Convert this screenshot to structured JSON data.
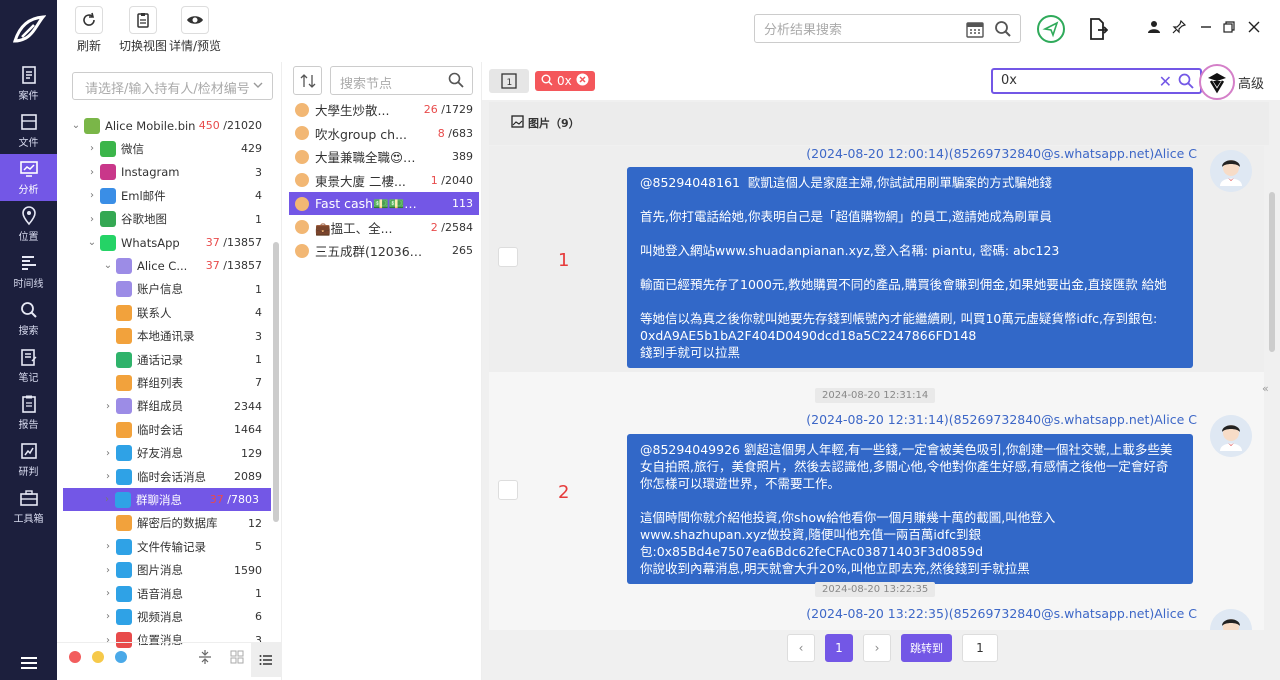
{
  "toolbar": {
    "refresh": "刷新",
    "switch_view": "切换视图",
    "details": "详情/预览",
    "search_placeholder": "分析结果搜索"
  },
  "leftnav": [
    {
      "label": "案件",
      "icon": "case-icon"
    },
    {
      "label": "文件",
      "icon": "folder-icon"
    },
    {
      "label": "分析",
      "icon": "analysis-icon",
      "active": true
    },
    {
      "label": "位置",
      "icon": "location-icon"
    },
    {
      "label": "时间线",
      "icon": "timeline-icon"
    },
    {
      "label": "搜索",
      "icon": "search-icon"
    },
    {
      "label": "笔记",
      "icon": "note-icon"
    },
    {
      "label": "报告",
      "icon": "report-icon"
    },
    {
      "label": "研判",
      "icon": "judge-icon"
    },
    {
      "label": "工具箱",
      "icon": "toolbox-icon"
    }
  ],
  "tree": {
    "placeholder": "请选择/输入持有人/检材编号",
    "items": [
      {
        "label": "Alice Mobile.bin",
        "red": "450",
        "count": "/21020",
        "level": 0,
        "arrow": "down",
        "icon": "android-icon",
        "color": "#7ab648"
      },
      {
        "label": "微信",
        "count": "429",
        "level": 1,
        "arrow": "right",
        "icon": "wechat-icon",
        "color": "#3bb54a"
      },
      {
        "label": "Instagram",
        "count": "3",
        "level": 1,
        "arrow": "right",
        "icon": "instagram-icon",
        "color": "#c9378a"
      },
      {
        "label": "Eml邮件",
        "count": "4",
        "level": 1,
        "arrow": "right",
        "icon": "mail-icon",
        "color": "#3a8ee6"
      },
      {
        "label": "谷歌地图",
        "count": "1",
        "level": 1,
        "arrow": "right",
        "icon": "map-icon",
        "color": "#34a853"
      },
      {
        "label": "WhatsApp",
        "red": "37",
        "count": "/13857",
        "level": 1,
        "arrow": "down",
        "icon": "whatsapp-icon",
        "color": "#25d366"
      },
      {
        "label": "Alice C...",
        "red": "37",
        "count": "/13857",
        "level": 2,
        "arrow": "down",
        "icon": "user-icon",
        "color": "#9c8ce6"
      },
      {
        "label": "账户信息",
        "count": "1",
        "level": 3,
        "icon": "account-icon",
        "color": "#9c8ce6"
      },
      {
        "label": "联系人",
        "count": "4",
        "level": 3,
        "icon": "contact-icon",
        "color": "#f2a23c"
      },
      {
        "label": "本地通讯录",
        "count": "3",
        "level": 3,
        "icon": "addressbook-icon",
        "color": "#f2a23c"
      },
      {
        "label": "通话记录",
        "count": "1",
        "level": 3,
        "icon": "phone-icon",
        "color": "#2fb36b"
      },
      {
        "label": "群组列表",
        "count": "7",
        "level": 3,
        "icon": "grouplist-icon",
        "color": "#f2a23c"
      },
      {
        "label": "群组成员",
        "count": "2344",
        "level": 3,
        "arrow": "right",
        "icon": "groupmember-icon",
        "color": "#9c8ce6"
      },
      {
        "label": "临时会话",
        "count": "1464",
        "level": 3,
        "icon": "temp-session-icon",
        "color": "#f2a23c"
      },
      {
        "label": "好友消息",
        "count": "129",
        "level": 3,
        "arrow": "right",
        "icon": "chat-bubble-icon",
        "color": "#2fa2e6"
      },
      {
        "label": "临时会话消息",
        "count": "2089",
        "level": 3,
        "arrow": "right",
        "icon": "chat-bubble-icon",
        "color": "#2fa2e6"
      },
      {
        "label": "群聊消息",
        "red": "37",
        "count": "/7803",
        "level": 3,
        "arrow": "right",
        "icon": "chat-bubble-icon",
        "color": "#2fa2e6",
        "selected": true
      },
      {
        "label": "解密后的数据库",
        "count": "12",
        "level": 3,
        "icon": "database-icon",
        "color": "#f2a23c"
      },
      {
        "label": "文件传输记录",
        "count": "5",
        "level": 3,
        "arrow": "right",
        "icon": "chat-bubble-icon",
        "color": "#2fa2e6"
      },
      {
        "label": "图片消息",
        "count": "1590",
        "level": 3,
        "arrow": "right",
        "icon": "chat-bubble-icon",
        "color": "#2fa2e6"
      },
      {
        "label": "语音消息",
        "count": "1",
        "level": 3,
        "arrow": "right",
        "icon": "chat-bubble-icon",
        "color": "#2fa2e6"
      },
      {
        "label": "视频消息",
        "count": "6",
        "level": 3,
        "arrow": "right",
        "icon": "chat-bubble-icon",
        "color": "#2fa2e6"
      },
      {
        "label": "位置消息",
        "count": "3",
        "level": 3,
        "arrow": "right",
        "icon": "location-pin-icon",
        "color": "#e84b4b"
      }
    ]
  },
  "chatlist": {
    "placeholder": "搜索节点",
    "items": [
      {
        "name": "大學生炒散...",
        "red": "26",
        "count": "/1729"
      },
      {
        "name": "吹水group ch...",
        "red": "8",
        "count": "/683"
      },
      {
        "name": "大量兼職全職😍🔥...",
        "count": "389"
      },
      {
        "name": "東景大廈 二樓...",
        "red": "1",
        "count": "/2040"
      },
      {
        "name": "Fast cash💵💵💵...",
        "count": "113",
        "selected": true
      },
      {
        "name": "💼搵工、全...",
        "red": "2",
        "count": "/2584"
      },
      {
        "name": "三五成群(1203633...",
        "count": "265"
      }
    ]
  },
  "content": {
    "tag_label": "0x",
    "filter_value": "0x",
    "advanced": "高级",
    "tab_label": "图片（9）",
    "messages": [
      {
        "index": "1",
        "sender": "(2024-08-20 12:00:14)(85269732840@s.whatsapp.net)Alice C",
        "text": "@85294048161  歐凱這個人是家庭主婦,你試試用刷單騙案的方式騙她錢\n\n首先,你打電話給她,你表明自己是「超值購物網」的員工,邀請她成為刷單員\n\n叫她登入網站www.shuadanpianan.xyz,登入名稱: piantu, 密碼: abc123\n\n輸面已經預先存了1000元,教她購買不同的產品,購買後會賺到佣金,如果她要出金,直接匯款 給她\n\n等她信以為真之後你就叫她要先存錢到帳號內才能繼續刷, 叫買10萬元虛疑貨幣idfc,存到銀包: 0xdA9AE5b1bA2F404D0490dcd18a5C2247866FD148\n錢到手就可以拉黑"
      },
      {
        "timestamp": "2024-08-20 12:31:14",
        "index": "2",
        "sender": "(2024-08-20 12:31:14)(85269732840@s.whatsapp.net)Alice C",
        "text": "@85294049926 劉超這個男人年輕,有一些錢,一定會被美色吸引,你創建一個社交號,上載多些美女自拍照,旅行，美食照片，然後去認識他,多關心他,令他對你產生好感,有感情之後他一定會好奇你怎樣可以環遊世界，不需要工作。\n\n這個時間你就介紹他投資,你show給他看你一個月賺幾十萬的截圖,叫他登入 www.shazhupan.xyz做投資,隨便叫他充值一兩百萬idfc到銀包:0x85Bd4e7507ea6Bdc62feCFAc03871403F3d0859d\n你說收到內幕消息,明天就會大升20%,叫他立即去充,然後錢到手就拉黑"
      },
      {
        "timestamp": "2024-08-20 13:22:35",
        "sender": "(2024-08-20 13:22:35)(85269732840@s.whatsapp.net)Alice C"
      }
    ]
  },
  "pager": {
    "current": "1",
    "goto": "跳转到",
    "input_value": "1"
  },
  "colors": {
    "accent": "#7357e6",
    "nav_bg": "#1c1f3d",
    "bubble": "#3268c8",
    "alert_red": "#e84b4b"
  }
}
